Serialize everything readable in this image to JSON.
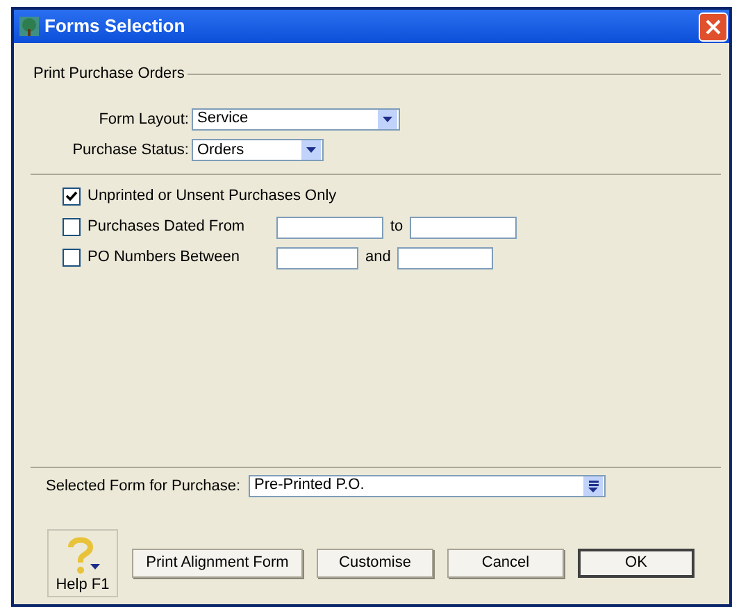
{
  "window": {
    "title": "Forms Selection"
  },
  "group": {
    "title": "Print Purchase Orders"
  },
  "form_layout": {
    "label": "Form Layout:",
    "value": "Service"
  },
  "purchase_status": {
    "label": "Purchase Status:",
    "value": "Orders"
  },
  "filters": [
    {
      "kind": "check",
      "label": "Unprinted or Unsent Purchases Only",
      "checked": true
    },
    {
      "kind": "range",
      "label": "Purchases Dated From",
      "checked": false,
      "joiner": "to"
    },
    {
      "kind": "range",
      "label": "PO Numbers Between",
      "checked": false,
      "joiner": "and"
    }
  ],
  "selected_form": {
    "label": "Selected Form for Purchase:",
    "value": "Pre-Printed P.O."
  },
  "help": {
    "label": "Help F1"
  },
  "buttons": [
    {
      "label": "Print Alignment Form",
      "default": false
    },
    {
      "label": "Customise",
      "default": false
    },
    {
      "label": "Cancel",
      "default": false
    },
    {
      "label": "OK",
      "default": true
    }
  ]
}
